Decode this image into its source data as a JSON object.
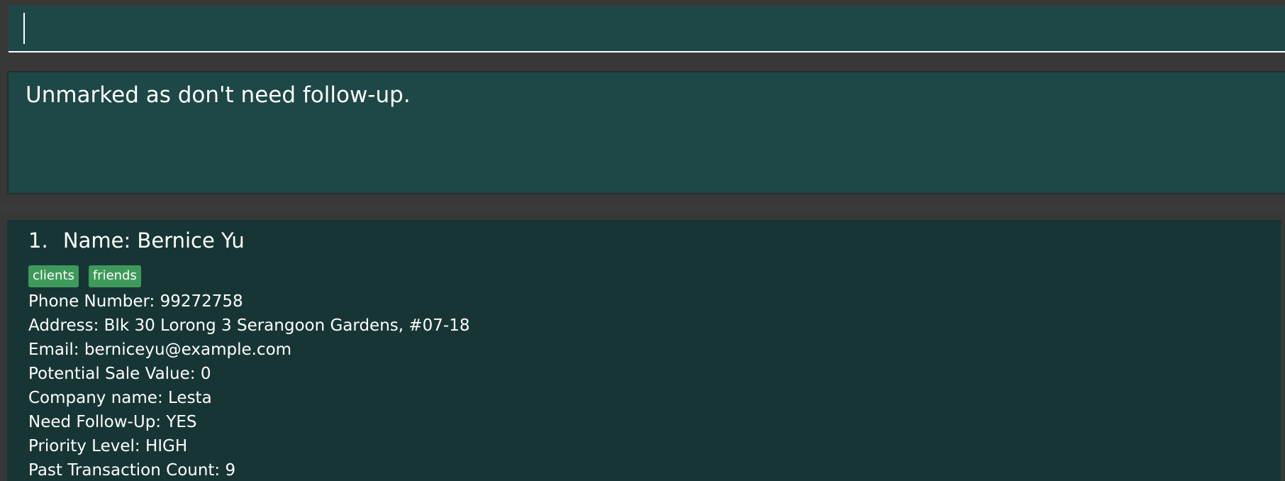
{
  "command": {
    "value": "",
    "placeholder": ""
  },
  "result": {
    "message": "Unmarked as don't need follow-up."
  },
  "persons": [
    {
      "index": "1.",
      "name": "Name: Bernice Yu",
      "tags": [
        "clients",
        "friends"
      ],
      "phone": "Phone Number: 99272758",
      "address": "Address: Blk 30 Lorong 3 Serangoon Gardens, #07-18",
      "email": "Email: berniceyu@example.com",
      "sale_value": "Potential Sale Value: 0",
      "company": "Company name: Lesta",
      "follow_up": "Need Follow-Up: YES",
      "priority": "Priority Level: HIGH",
      "transactions": "Past Transaction Count: 9"
    }
  ],
  "colors": {
    "background": "#3a3a3a",
    "panel": "#1e4747",
    "card": "#183535",
    "tag": "#3e9a5a",
    "text": "#ffffff"
  }
}
